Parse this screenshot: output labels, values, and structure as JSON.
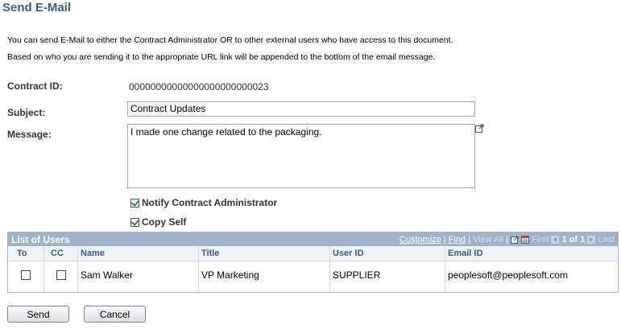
{
  "page_title": "Send E-Mail",
  "instructions": [
    "You can send E-Mail to either the Contract Administrator OR to other external users who have access to this document.",
    "Based on who you are sending it to the appropriate URL link will be appended to the bottom of the email message."
  ],
  "form": {
    "contract_id_label": "Contract ID:",
    "contract_id_value": "00000000000000000000000023",
    "subject_label": "Subject:",
    "subject_value": "Contract  Updates",
    "message_label": "Message:",
    "message_value": "I made one change related to the packaging.",
    "notify_label": "Notify Contract Administrator",
    "notify_checked": true,
    "copy_self_label": "Copy Self",
    "copy_self_checked": true
  },
  "grid": {
    "title": "List of Users",
    "nav": {
      "customize": "Customize",
      "sep1": "|",
      "find": "Find",
      "sep2": "|",
      "view_all": "View All",
      "sep3": "|",
      "first": "First",
      "range": "1 of 1",
      "last": "Last"
    },
    "columns": [
      "To",
      "CC",
      "Name",
      "Title",
      "User ID",
      "Email ID"
    ],
    "rows": [
      {
        "to": false,
        "cc": false,
        "name": "Sam Walker",
        "title": "VP Marketing",
        "user_id": "SUPPLIER",
        "email": "peoplesoft@peoplesoft.com"
      }
    ]
  },
  "buttons": {
    "send": "Send",
    "cancel": "Cancel"
  },
  "colors": {
    "title": "#3a5b8a",
    "grid_header": "#9fb3cb",
    "checkmark": "#2f8f2f"
  }
}
